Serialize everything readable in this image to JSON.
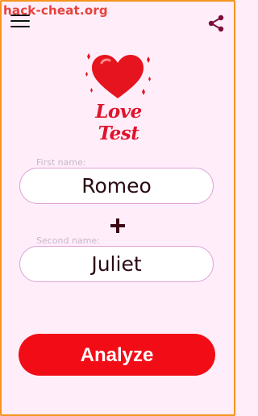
{
  "watermark": "hack-cheat.org",
  "header": {
    "menu_icon": "hamburger-menu-icon",
    "share_icon": "share-icon"
  },
  "logo": {
    "title": "Love Test",
    "icon": "heart-icon"
  },
  "form": {
    "first_label": "First name:",
    "first_value": "Romeo",
    "second_label": "Second name:",
    "second_value": "Juliet",
    "plus_icon": "plus-icon"
  },
  "analyze_label": "Analyze",
  "colors": {
    "accent": "#f20d16",
    "background": "#ffeefa",
    "frame": "#f7941d"
  }
}
